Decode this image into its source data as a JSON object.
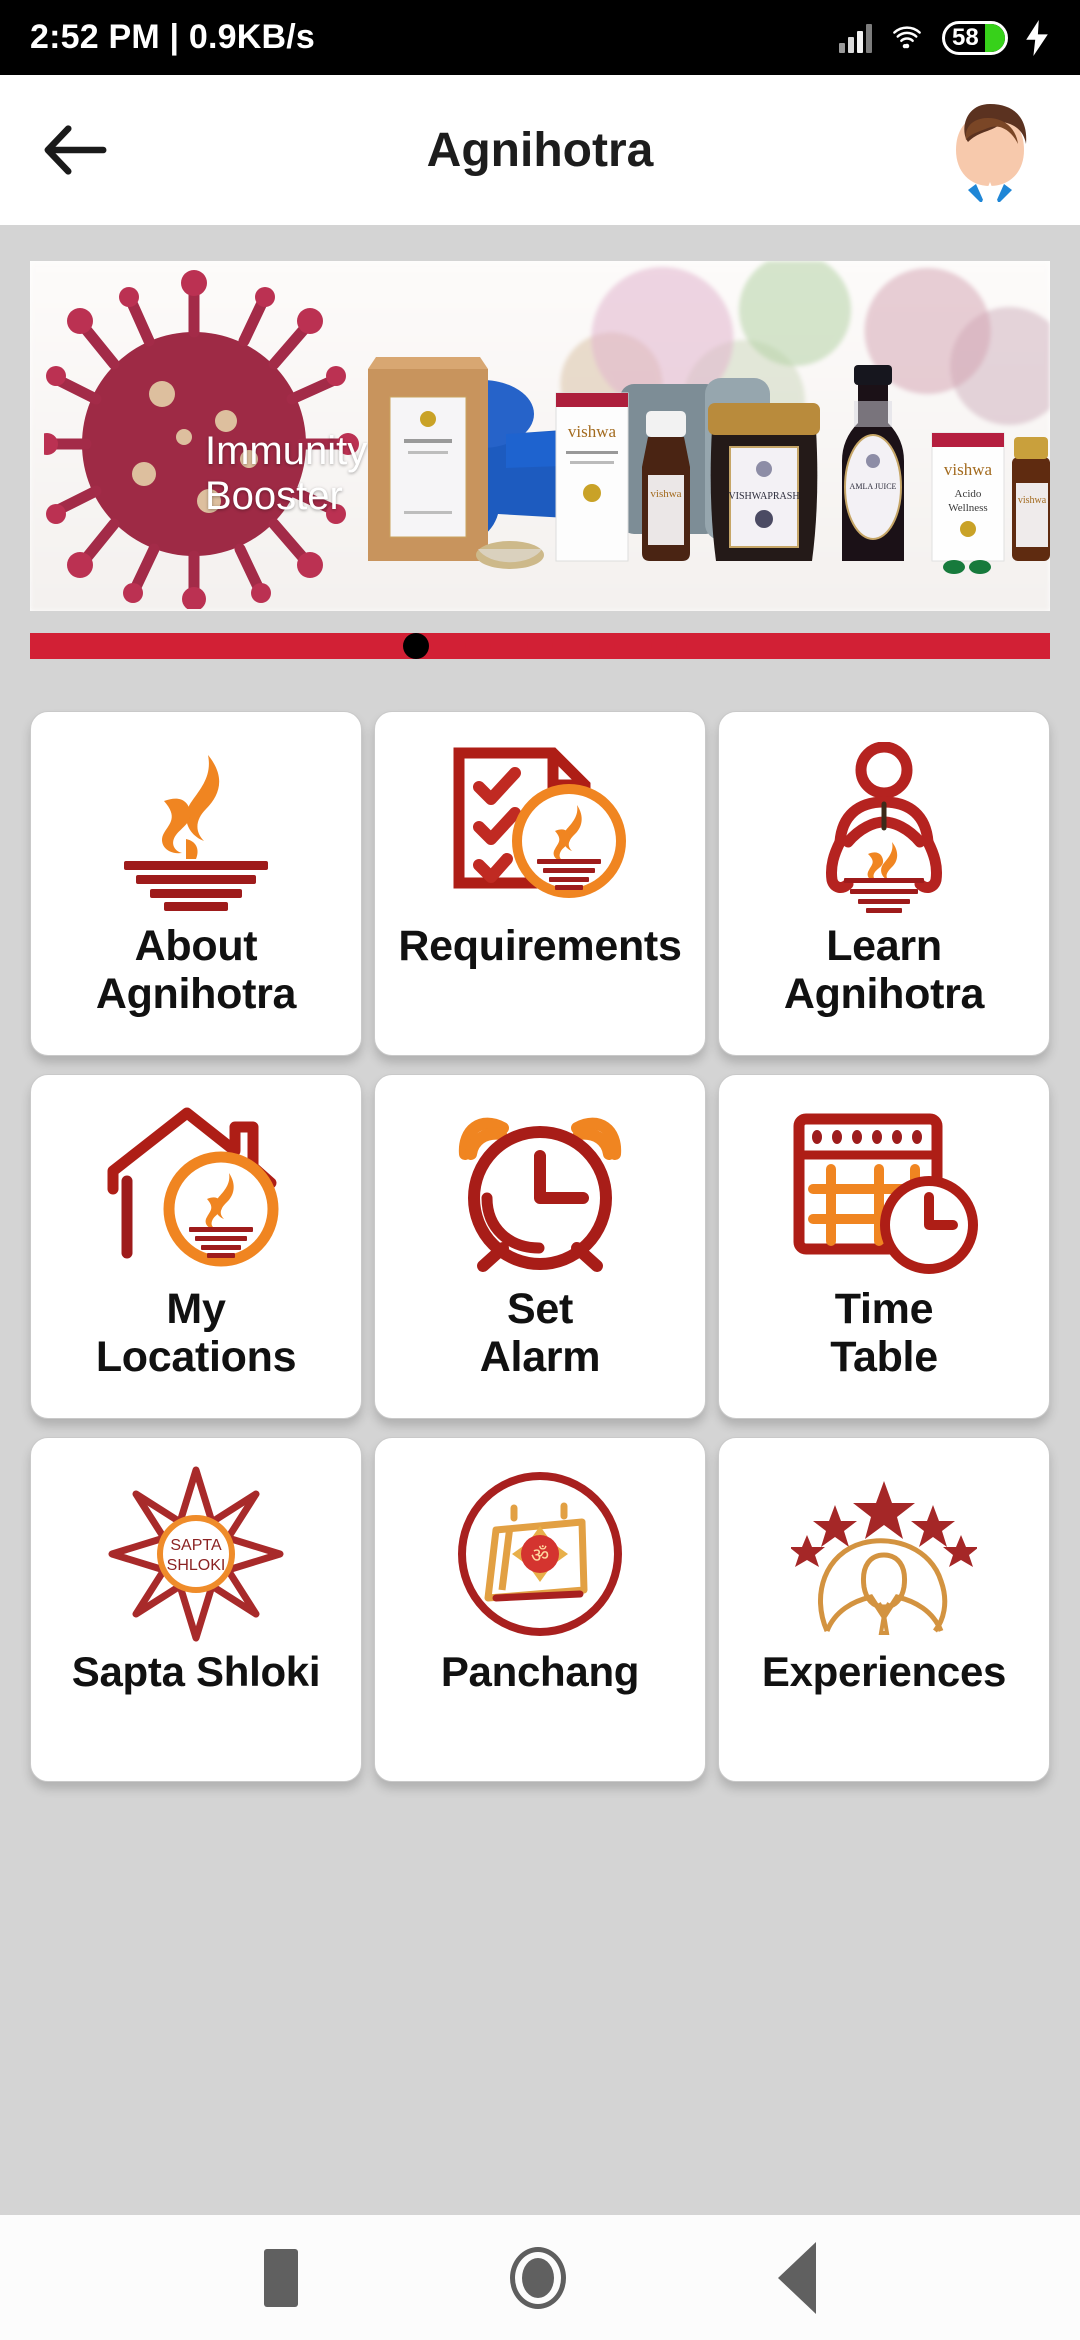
{
  "status_bar": {
    "time_and_speed": "2:52 PM | 0.9KB/s",
    "battery_level": "58",
    "icons": [
      "signal-bars-icon",
      "wifi-icon",
      "battery-icon",
      "charging-bolt-icon"
    ]
  },
  "app_bar": {
    "title": "Agnihotra",
    "back_icon": "back-arrow-icon",
    "avatar_icon": "user-avatar-icon"
  },
  "banner": {
    "headline_line1": "Immunity",
    "headline_line2": "Booster",
    "alt": "Immunity Booster products banner",
    "brand": "vishwa",
    "dots": [
      {
        "active": false,
        "color": "#d22035"
      },
      {
        "active": true,
        "color": "#000000"
      },
      {
        "active": false,
        "color": "#d22035"
      },
      {
        "active": false,
        "color": "#d22035"
      },
      {
        "active": false,
        "color": "#d22035"
      }
    ]
  },
  "theme": {
    "red": "#a81d18",
    "orange": "#ef8022",
    "deep_red": "#9e1b1b",
    "background": "#d4d4d4",
    "card": "#ffffff",
    "dot_red": "#d22035"
  },
  "grid": {
    "tiles": [
      {
        "label_line1": "About",
        "label_line2": "Agnihotra",
        "icon": "agnihotra-kunda-flame-icon"
      },
      {
        "label_line1": "Requirements",
        "label_line2": "",
        "icon": "checklist-document-kunda-icon"
      },
      {
        "label_line1": "Learn",
        "label_line2": "Agnihotra",
        "icon": "meditating-person-kunda-icon"
      },
      {
        "label_line1": "My",
        "label_line2": "Locations",
        "icon": "house-kunda-icon"
      },
      {
        "label_line1": "Set",
        "label_line2": "Alarm",
        "icon": "alarm-clock-icon"
      },
      {
        "label_line1": "Time",
        "label_line2": "Table",
        "icon": "calendar-clock-icon"
      },
      {
        "label_line1": "Sapta Shloki",
        "label_line2": "",
        "icon": "sun-star-sapta-shloki-icon",
        "inner_text_line1": "SAPTA",
        "inner_text_line2": "SHLOKI"
      },
      {
        "label_line1": "Panchang",
        "label_line2": "",
        "icon": "calendar-om-icon"
      },
      {
        "label_line1": "Experiences",
        "label_line2": "",
        "icon": "person-stars-icon"
      }
    ]
  },
  "nav_bar": {
    "recents_label": "recents-square-icon",
    "home_label": "home-circle-icon",
    "back_label": "back-triangle-icon"
  }
}
